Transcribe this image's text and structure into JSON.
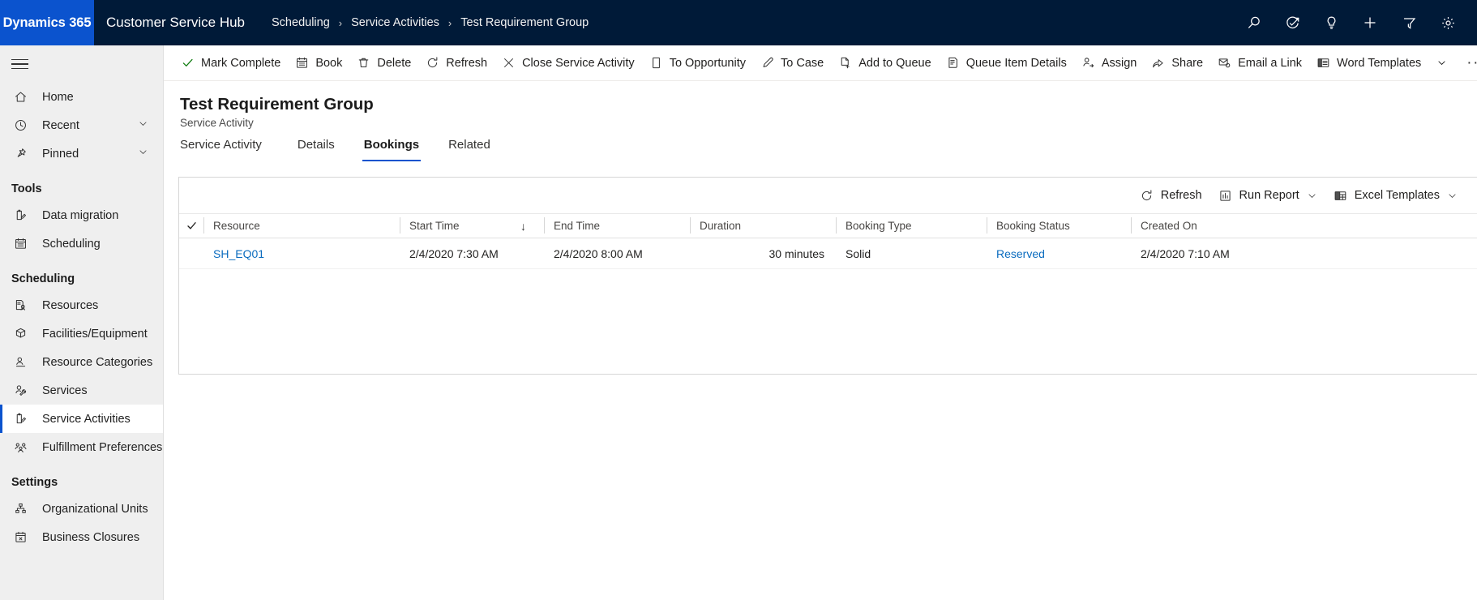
{
  "topbar": {
    "brand": "Dynamics 365",
    "app_name": "Customer Service Hub",
    "breadcrumb": [
      "Scheduling",
      "Service Activities",
      "Test Requirement Group"
    ],
    "separator": "›",
    "icons": [
      {
        "name": "search-icon",
        "label": "Search"
      },
      {
        "name": "assistant-check-icon",
        "label": "Assistant"
      },
      {
        "name": "lightbulb-icon",
        "label": "Tips"
      },
      {
        "name": "plus-icon",
        "label": "New"
      },
      {
        "name": "filter-icon",
        "label": "Filter"
      },
      {
        "name": "gear-icon",
        "label": "Settings"
      }
    ],
    "brand_color": "#0b53ce",
    "bar_color": "#001a38"
  },
  "sidebar": {
    "hamburger_label": "Site Map",
    "items": [
      {
        "label": "Home",
        "icon": "home-icon",
        "type": "item",
        "selected": false,
        "chevron": false
      },
      {
        "label": "Recent",
        "icon": "clock-icon",
        "type": "item",
        "selected": false,
        "chevron": true
      },
      {
        "label": "Pinned",
        "icon": "pin-icon",
        "type": "item",
        "selected": false,
        "chevron": true
      },
      {
        "label": "Tools",
        "type": "group"
      },
      {
        "label": "Data migration",
        "icon": "clipboard-pencil-icon",
        "type": "item",
        "selected": false,
        "chevron": false
      },
      {
        "label": "Scheduling",
        "icon": "calendar-icon",
        "type": "item",
        "selected": false,
        "chevron": false
      },
      {
        "label": "Scheduling",
        "type": "group"
      },
      {
        "label": "Resources",
        "icon": "resource-icon",
        "type": "item",
        "selected": false,
        "chevron": false
      },
      {
        "label": "Facilities/Equipment",
        "icon": "box-icon",
        "type": "item",
        "selected": false,
        "chevron": false
      },
      {
        "label": "Resource Categories",
        "icon": "person-line-icon",
        "type": "item",
        "selected": false,
        "chevron": false
      },
      {
        "label": "Services",
        "icon": "person-wrench-icon",
        "type": "item",
        "selected": false,
        "chevron": false
      },
      {
        "label": "Service Activities",
        "icon": "clipboard-pencil-icon",
        "type": "item",
        "selected": true,
        "chevron": false
      },
      {
        "label": "Fulfillment Preferences",
        "icon": "people-group-icon",
        "type": "item",
        "selected": false,
        "chevron": false
      },
      {
        "label": "Settings",
        "type": "group"
      },
      {
        "label": "Organizational Units",
        "icon": "hierarchy-icon",
        "type": "item",
        "selected": false,
        "chevron": false
      },
      {
        "label": "Business Closures",
        "icon": "calendar-x-icon",
        "type": "item",
        "selected": false,
        "chevron": false
      }
    ],
    "selected_accent": "#0b53ce"
  },
  "command_bar": {
    "commands": [
      {
        "label": "Mark Complete",
        "icon": "check-icon"
      },
      {
        "label": "Book",
        "icon": "calendar-icon"
      },
      {
        "label": "Delete",
        "icon": "trash-icon"
      },
      {
        "label": "Refresh",
        "icon": "refresh-icon"
      },
      {
        "label": "Close Service Activity",
        "icon": "close-x-icon"
      },
      {
        "label": "To Opportunity",
        "icon": "document-icon"
      },
      {
        "label": "To Case",
        "icon": "pen-icon"
      },
      {
        "label": "Add to Queue",
        "icon": "document-plus-icon"
      },
      {
        "label": "Queue Item Details",
        "icon": "list-detail-icon"
      },
      {
        "label": "Assign",
        "icon": "person-arrow-icon"
      },
      {
        "label": "Share",
        "icon": "share-icon"
      },
      {
        "label": "Email a Link",
        "icon": "email-link-icon"
      },
      {
        "label": "Word Templates",
        "icon": "word-icon",
        "has_chevron": true
      }
    ],
    "overflow_label": "···"
  },
  "form": {
    "title": "Test Requirement Group",
    "subtitle": "Service Activity",
    "tabs": [
      {
        "label": "Service Activity",
        "active": false
      },
      {
        "label": "Details",
        "active": false
      },
      {
        "label": "Bookings",
        "active": true
      },
      {
        "label": "Related",
        "active": false
      }
    ],
    "tab_accent": "#0b53ce"
  },
  "grid": {
    "toolbar": [
      {
        "label": "Refresh",
        "icon": "refresh-icon",
        "has_chevron": false
      },
      {
        "label": "Run Report",
        "icon": "report-chart-icon",
        "has_chevron": true
      },
      {
        "label": "Excel Templates",
        "icon": "excel-icon",
        "has_chevron": true
      }
    ],
    "select_all_icon": "checkmark-icon",
    "sort_indicator": "↓",
    "sorted_column": "Start Time",
    "columns": [
      {
        "key": "resource",
        "label": "Resource",
        "align": "left"
      },
      {
        "key": "start_time",
        "label": "Start Time",
        "align": "left"
      },
      {
        "key": "end_time",
        "label": "End Time",
        "align": "left"
      },
      {
        "key": "duration",
        "label": "Duration",
        "align": "left"
      },
      {
        "key": "booking_type",
        "label": "Booking Type",
        "align": "left"
      },
      {
        "key": "booking_status",
        "label": "Booking Status",
        "align": "left"
      },
      {
        "key": "created_on",
        "label": "Created On",
        "align": "left"
      }
    ],
    "rows": [
      {
        "resource": "SH_EQ01",
        "start_time": "2/4/2020 7:30 AM",
        "end_time": "2/4/2020 8:00 AM",
        "duration": "30 minutes",
        "booking_type": "Solid",
        "booking_status": "Reserved",
        "created_on": "2/4/2020 7:10 AM"
      }
    ],
    "link_color": "#0b6cbf"
  }
}
